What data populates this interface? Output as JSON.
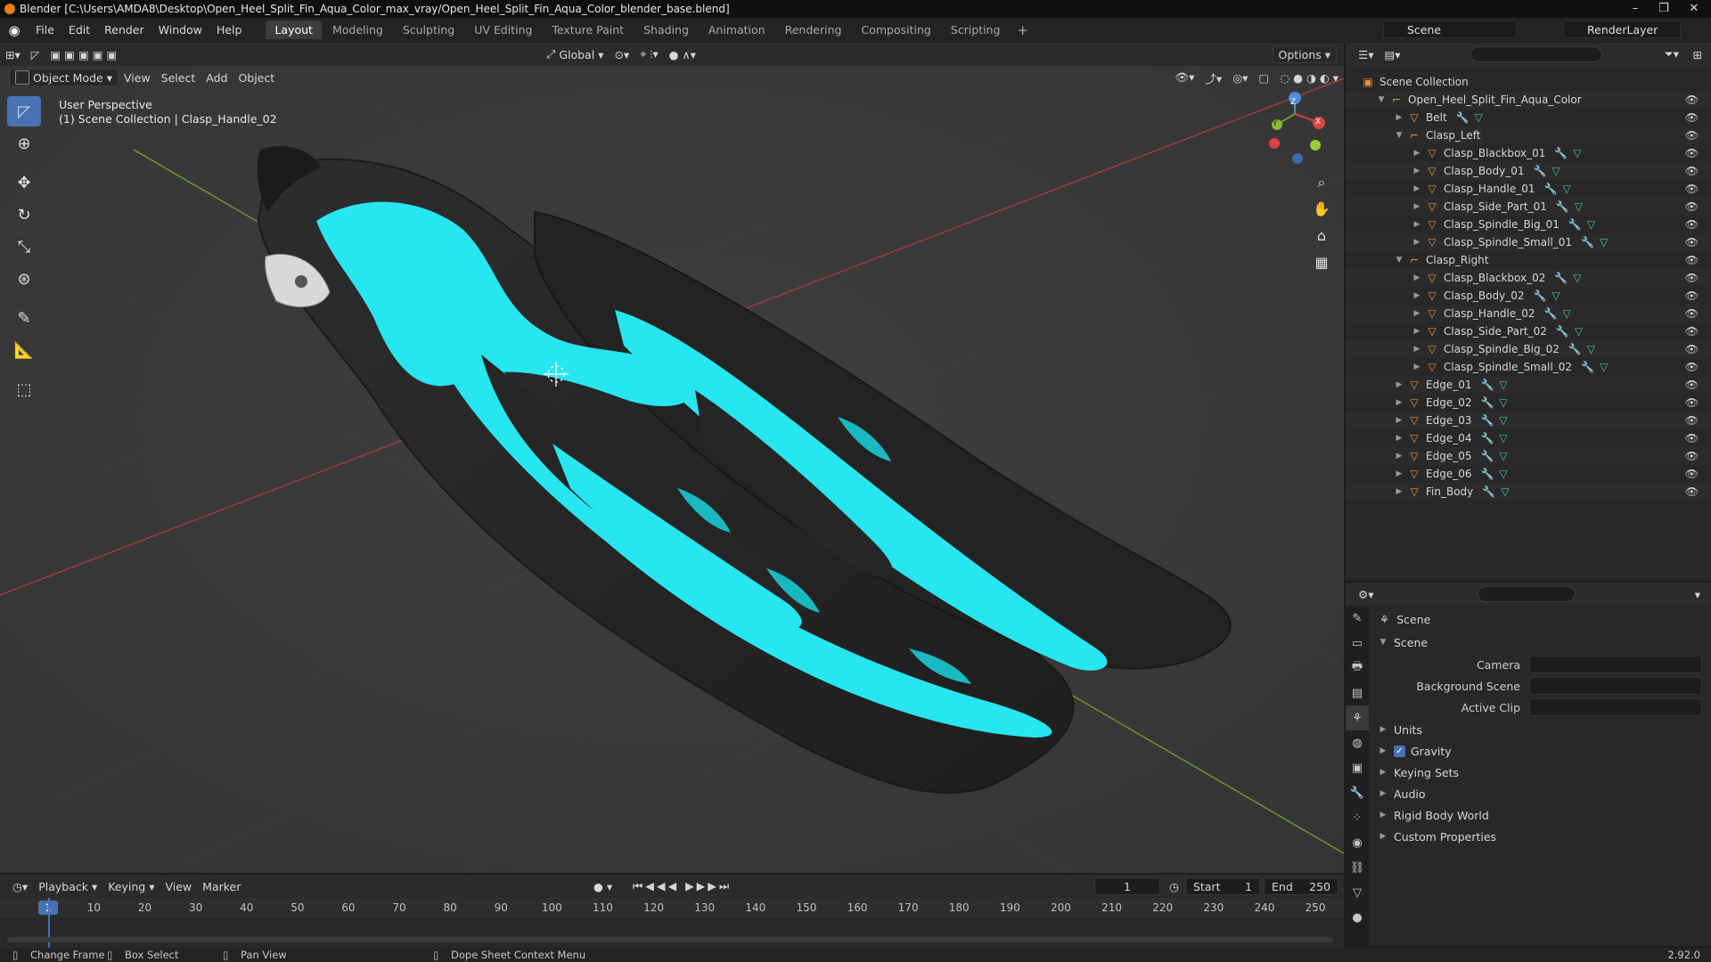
{
  "window": {
    "title": "Blender [C:\\Users\\AMDA8\\Desktop\\Open_Heel_Split_Fin_Aqua_Color_max_vray/Open_Heel_Split_Fin_Aqua_Color_blender_base.blend]",
    "minimize": "–",
    "restore": "❐",
    "close": "✕"
  },
  "menu": {
    "items": [
      "File",
      "Edit",
      "Render",
      "Window",
      "Help"
    ],
    "workspaces": [
      "Layout",
      "Modeling",
      "Sculpting",
      "UV Editing",
      "Texture Paint",
      "Shading",
      "Animation",
      "Rendering",
      "Compositing",
      "Scripting"
    ],
    "active_workspace": "Layout",
    "add_tab": "+",
    "scene": "Scene",
    "render_layer": "RenderLayer"
  },
  "viewport": {
    "mode": "Object Mode",
    "menus": [
      "View",
      "Select",
      "Add",
      "Object"
    ],
    "orientation": "Global",
    "options": "Options",
    "perspective": "User Perspective",
    "context": "(1) Scene Collection | Clasp_Handle_02",
    "gizmo_axes": [
      "X",
      "Y",
      "Z"
    ],
    "colors": {
      "background": "#393939",
      "fin_black": "#242424",
      "fin_aqua": "#27e6f0",
      "x_axis": "#9a3b3b",
      "y_axis": "#6b8f2e"
    }
  },
  "outliner": {
    "root": "Scene Collection",
    "items": [
      {
        "name": "Open_Heel_Split_Fin_Aqua_Color",
        "level": 1,
        "type": "collection",
        "expanded": true
      },
      {
        "name": "Belt",
        "level": 2,
        "type": "mesh"
      },
      {
        "name": "Clasp_Left",
        "level": 2,
        "type": "collection",
        "expanded": true
      },
      {
        "name": "Clasp_Blackbox_01",
        "level": 3,
        "type": "mesh"
      },
      {
        "name": "Clasp_Body_01",
        "level": 3,
        "type": "mesh"
      },
      {
        "name": "Clasp_Handle_01",
        "level": 3,
        "type": "mesh"
      },
      {
        "name": "Clasp_Side_Part_01",
        "level": 3,
        "type": "mesh"
      },
      {
        "name": "Clasp_Spindle_Big_01",
        "level": 3,
        "type": "mesh"
      },
      {
        "name": "Clasp_Spindle_Small_01",
        "level": 3,
        "type": "mesh"
      },
      {
        "name": "Clasp_Right",
        "level": 2,
        "type": "collection",
        "expanded": true
      },
      {
        "name": "Clasp_Blackbox_02",
        "level": 3,
        "type": "mesh"
      },
      {
        "name": "Clasp_Body_02",
        "level": 3,
        "type": "mesh"
      },
      {
        "name": "Clasp_Handle_02",
        "level": 3,
        "type": "mesh"
      },
      {
        "name": "Clasp_Side_Part_02",
        "level": 3,
        "type": "mesh"
      },
      {
        "name": "Clasp_Spindle_Big_02",
        "level": 3,
        "type": "mesh"
      },
      {
        "name": "Clasp_Spindle_Small_02",
        "level": 3,
        "type": "mesh"
      },
      {
        "name": "Edge_01",
        "level": 2,
        "type": "mesh"
      },
      {
        "name": "Edge_02",
        "level": 2,
        "type": "mesh"
      },
      {
        "name": "Edge_03",
        "level": 2,
        "type": "mesh"
      },
      {
        "name": "Edge_04",
        "level": 2,
        "type": "mesh"
      },
      {
        "name": "Edge_05",
        "level": 2,
        "type": "mesh"
      },
      {
        "name": "Edge_06",
        "level": 2,
        "type": "mesh"
      },
      {
        "name": "Fin_Body",
        "level": 2,
        "type": "mesh"
      }
    ]
  },
  "properties": {
    "context_title": "Scene",
    "panel_title": "Scene",
    "fields": [
      {
        "label": "Camera",
        "value": ""
      },
      {
        "label": "Background Scene",
        "value": ""
      },
      {
        "label": "Active Clip",
        "value": ""
      }
    ],
    "panels": [
      {
        "label": "Units",
        "checkbox": false
      },
      {
        "label": "Gravity",
        "checkbox": true
      },
      {
        "label": "Keying Sets",
        "checkbox": false
      },
      {
        "label": "Audio",
        "checkbox": false
      },
      {
        "label": "Rigid Body World",
        "checkbox": false
      },
      {
        "label": "Custom Properties",
        "checkbox": false
      }
    ]
  },
  "timeline": {
    "menus": [
      "Playback",
      "Keying",
      "View",
      "Marker"
    ],
    "current_frame": "1",
    "start_label": "Start",
    "start": "1",
    "end_label": "End",
    "end": "250",
    "ticks": [
      "1",
      "10",
      "20",
      "30",
      "40",
      "50",
      "60",
      "70",
      "80",
      "90",
      "100",
      "110",
      "120",
      "130",
      "140",
      "150",
      "160",
      "170",
      "180",
      "190",
      "200",
      "210",
      "220",
      "230",
      "240",
      "250"
    ]
  },
  "statusbar": {
    "items": [
      "Change Frame",
      "Box Select",
      "Pan View",
      "Dope Sheet Context Menu"
    ],
    "version": "2.92.0"
  }
}
